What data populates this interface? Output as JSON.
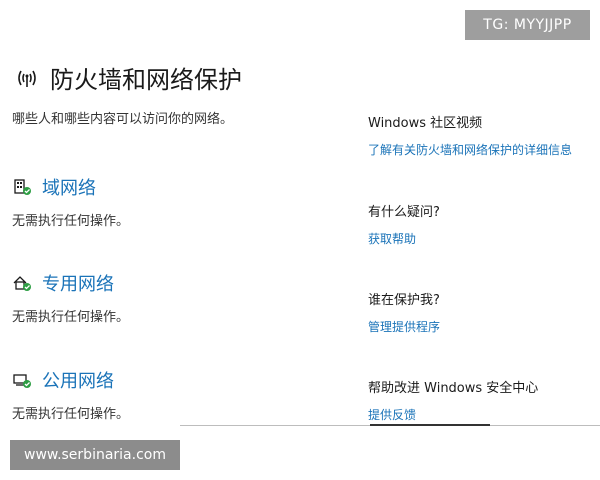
{
  "watermarks": {
    "top": "TG: MYYJJPP",
    "bottom": "www.serbinaria.com"
  },
  "header": {
    "title": "防火墙和网络保护",
    "subtitle": "哪些人和哪些内容可以访问你的网络。",
    "icon": "wifi-signal-icon"
  },
  "networks": [
    {
      "title": "域网络",
      "status": "无需执行任何操作。",
      "icon": "domain-network-icon"
    },
    {
      "title": "专用网络",
      "status": "无需执行任何操作。",
      "icon": "private-network-icon"
    },
    {
      "title": "公用网络",
      "status": "无需执行任何操作。",
      "icon": "public-network-icon"
    }
  ],
  "sidebar": [
    {
      "heading": "Windows 社区视频",
      "link": "了解有关防火墙和网络保护的详细信息"
    },
    {
      "heading": "有什么疑问?",
      "link": "获取帮助"
    },
    {
      "heading": "谁在保护我?",
      "link": "管理提供程序"
    },
    {
      "heading": "帮助改进 Windows 安全中心",
      "link": "提供反馈"
    }
  ],
  "colors": {
    "accent": "#1a73b8",
    "ok": "#2e9e44"
  }
}
